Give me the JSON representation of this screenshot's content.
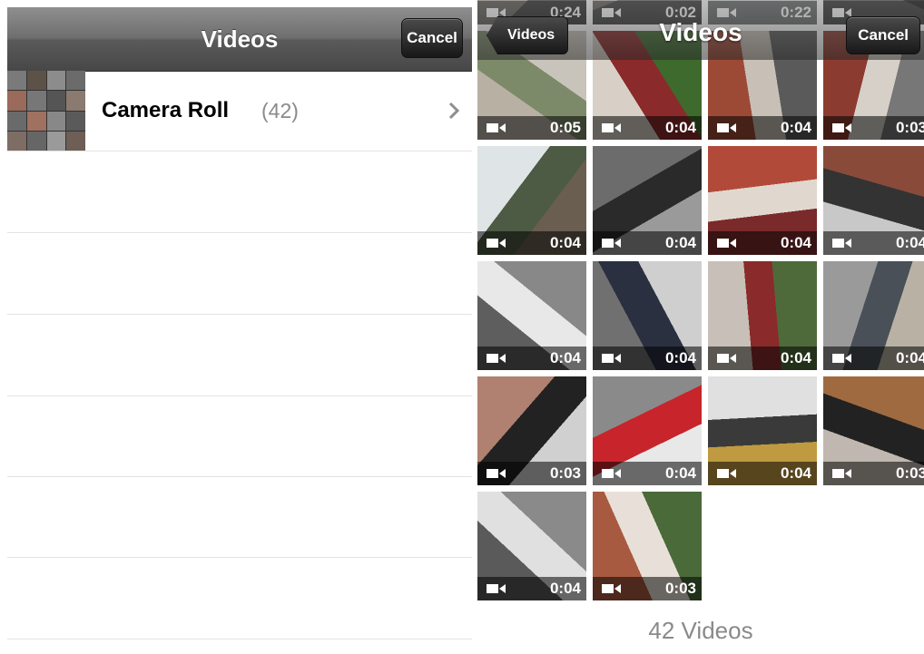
{
  "left_screen": {
    "title": "Videos",
    "cancel_label": "Cancel",
    "album": {
      "name": "Camera Roll",
      "count": "(42)"
    }
  },
  "right_screen": {
    "title": "Videos",
    "back_label": "Videos",
    "cancel_label": "Cancel",
    "top_row_partial_durations": [
      "0:24",
      "0:02",
      "0:22"
    ],
    "videos": [
      {
        "duration": "0:05"
      },
      {
        "duration": "0:04"
      },
      {
        "duration": "0:04"
      },
      {
        "duration": "0:03"
      },
      {
        "duration": "0:04"
      },
      {
        "duration": "0:04"
      },
      {
        "duration": "0:04"
      },
      {
        "duration": "0:04"
      },
      {
        "duration": "0:04"
      },
      {
        "duration": "0:04"
      },
      {
        "duration": "0:04"
      },
      {
        "duration": "0:04"
      },
      {
        "duration": "0:03"
      },
      {
        "duration": "0:04"
      },
      {
        "duration": "0:04"
      },
      {
        "duration": "0:03"
      },
      {
        "duration": "0:04"
      },
      {
        "duration": "0:03"
      }
    ],
    "footer": "42 Videos"
  },
  "colors": {
    "navbar_dark": "#474747",
    "button_dark": "#181818",
    "text_gray": "#8a8a8a",
    "separator": "#e3e3e3"
  },
  "icons": {
    "disclosure": "chevron-right-icon",
    "video_badge": "video-camera-icon"
  }
}
